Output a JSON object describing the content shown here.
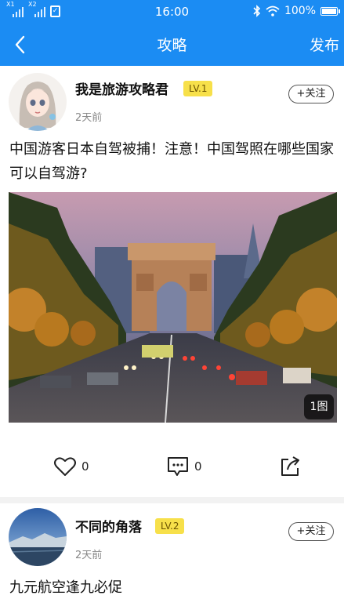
{
  "status_bar": {
    "sim1_label": "X1",
    "sim2_label": "X2",
    "time": "16:00",
    "battery": "100%",
    "battery_level": 1.0,
    "icons": [
      "signal-icon",
      "check-clipboard-icon",
      "bluetooth-icon",
      "wifi-icon",
      "battery-icon"
    ]
  },
  "nav": {
    "back_icon": "back-arrow-icon",
    "title": "攻略",
    "publish": "发布"
  },
  "colors": {
    "header": "#1b8cf3",
    "level_badge": "#f7e04a"
  },
  "posts": [
    {
      "username": "我是旅游攻略君",
      "level": "LV.1",
      "time": "2天前",
      "follow": "+关注",
      "text": "中国游客日本自驾被捕！注意！中国驾照在哪些国家可以自驾游?",
      "image_count": "1图",
      "likes": "0",
      "comments": "0",
      "icons": [
        "heart-icon",
        "comment-icon",
        "share-icon"
      ]
    },
    {
      "username": "不同的角落",
      "level": "LV.2",
      "time": "2天前",
      "follow": "+关注",
      "text": "九元航空逢九必促"
    }
  ]
}
